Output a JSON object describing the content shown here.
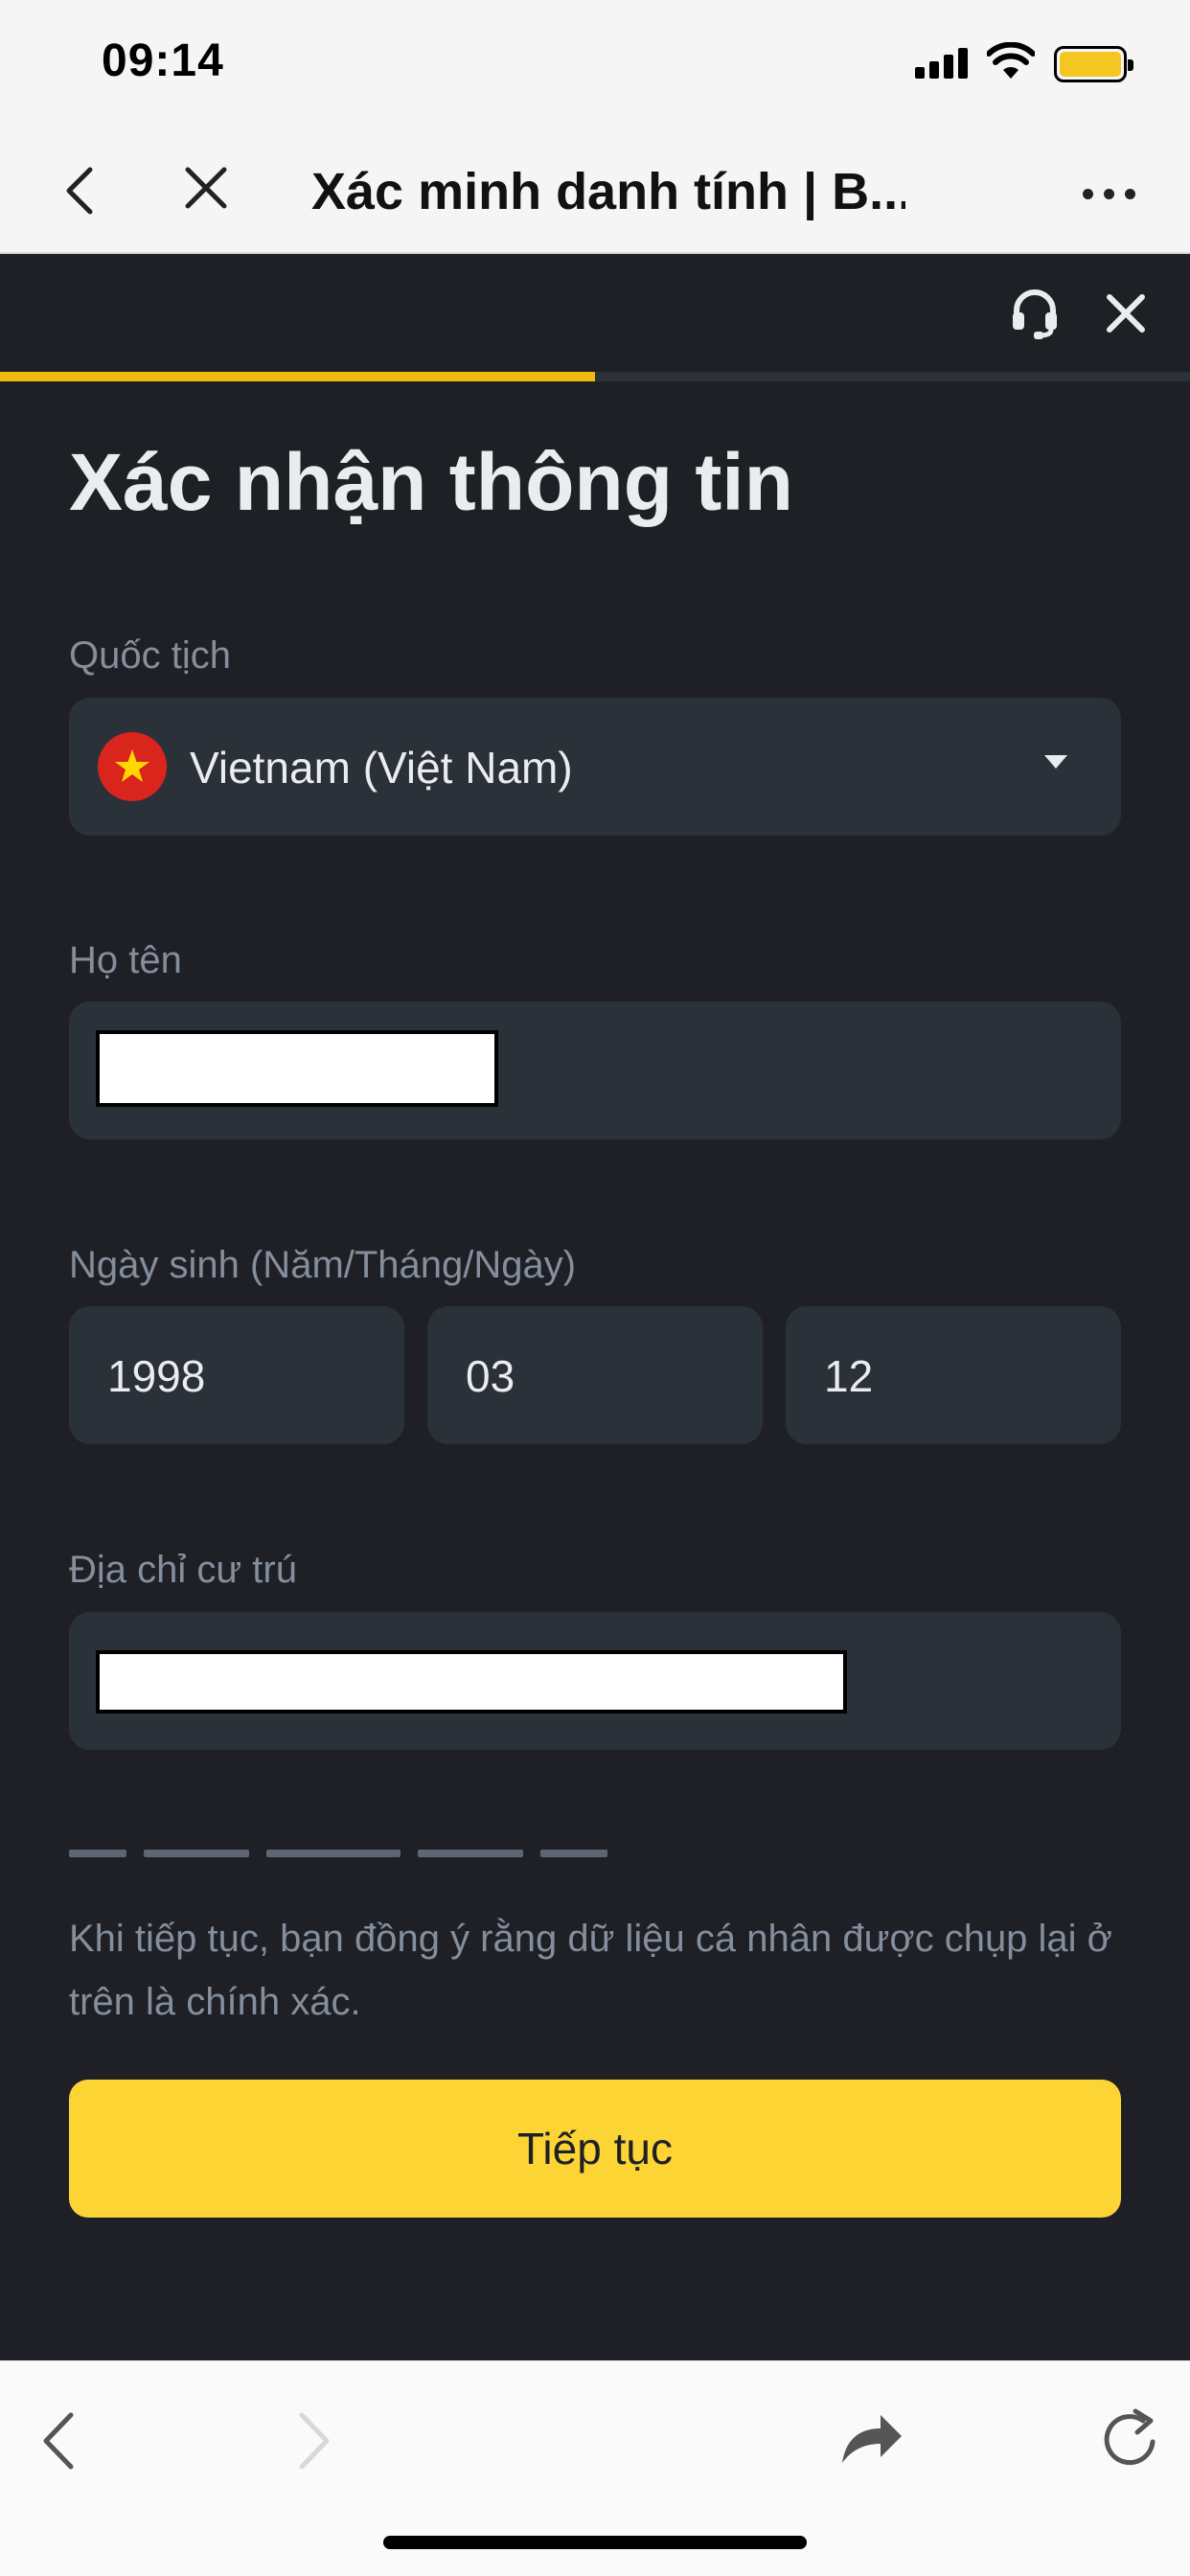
{
  "status_bar": {
    "time": "09:14"
  },
  "browser": {
    "title": "Xác minh danh tính | B..."
  },
  "form": {
    "progress": 0.5,
    "title": "Xác nhận thông tin",
    "nationality": {
      "label": "Quốc tịch",
      "value": "Vietnam (Việt Nam)"
    },
    "full_name": {
      "label": "Họ tên"
    },
    "dob": {
      "label": "Ngày sinh (Năm/Tháng/Ngày)",
      "year": "1998",
      "month": "03",
      "day": "12"
    },
    "address": {
      "label": "Địa chỉ cư trú"
    },
    "disclaimer": "Khi tiếp tục, bạn đồng ý rằng dữ liệu cá nhân được chụp lại ở trên là chính xác.",
    "continue_label": "Tiếp tục"
  },
  "colors": {
    "accent": "#fcd535",
    "progress": "#f0b90b",
    "background": "#1e2026",
    "field": "#2b3139",
    "label": "#848e9c"
  },
  "icons": {
    "nav_back": "chevron-left-icon",
    "nav_close": "close-icon",
    "nav_more": "more-icon",
    "support": "headset-icon",
    "app_close": "close-icon",
    "dropdown": "caret-down-icon",
    "flag": "vietnam-flag-icon",
    "toolbar_back": "chevron-left-icon",
    "toolbar_forward": "chevron-right-icon",
    "toolbar_share": "share-icon",
    "toolbar_reload": "reload-icon"
  }
}
